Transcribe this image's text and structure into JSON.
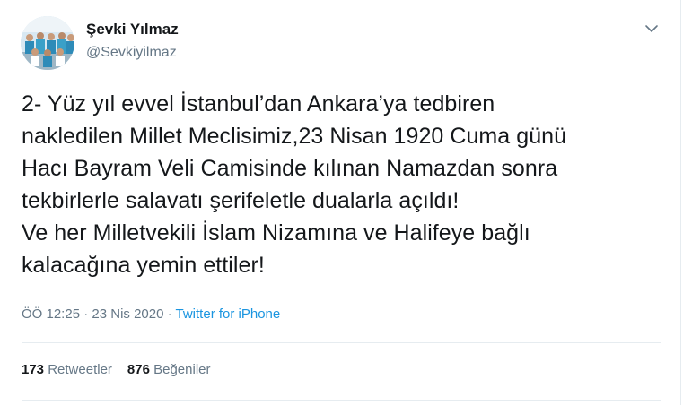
{
  "author": {
    "name": "Şevki Yılmaz",
    "handle": "@Sevkiyilmaz"
  },
  "tweet": {
    "text": "2- Yüz yıl evvel İstanbul’dan Ankara’ya tedbiren\nnakledilen Millet Meclisimiz,23 Nisan 1920 Cuma günü\nHacı Bayram Veli Camisinde kılınan Namazdan sonra\ntekbirlerle salavatı şerifeletle dualarla açıldı!\nVe her Milletvekili İslam Nizamına ve Halifeye bağlı\nkalacağına yemin ettiler!",
    "time": "ÖÖ 12:25",
    "separator": " · ",
    "date": "23 Nis 2020",
    "source": "Twitter for iPhone"
  },
  "stats": {
    "retweets_count": "173",
    "retweets_label": "Retweetler",
    "likes_count": "876",
    "likes_label": "Beğeniler"
  },
  "icons": {
    "caret": "chevron-down-icon"
  },
  "colors": {
    "text": "#14171a",
    "secondary": "#657786",
    "link": "#1b95e0",
    "divider": "#e6ecf0"
  }
}
